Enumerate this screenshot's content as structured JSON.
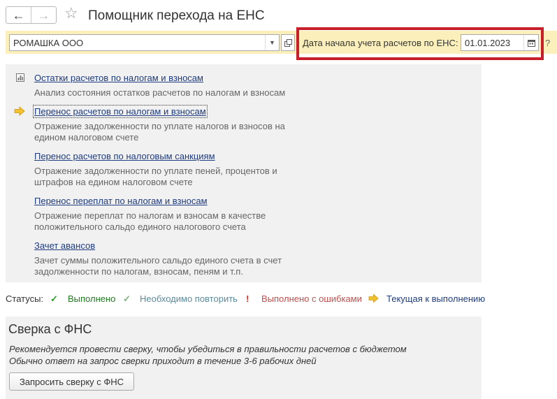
{
  "window": {
    "title": "Помощник перехода на ЕНС",
    "back_icon": "arrow-left-icon",
    "forward_icon": "arrow-right-icon",
    "favorite_icon": "star-icon"
  },
  "filters": {
    "organization": {
      "value": "РОМАШКА ООО"
    },
    "start_date": {
      "label": "Дата начала учета расчетов по ЕНС:",
      "value": "01.01.2023"
    },
    "help_label": "?"
  },
  "steps": [
    {
      "title": "Остатки расчетов по налогам и взносам",
      "description": "Анализ состояния остатков расчетов по налогам и взносам",
      "icon": "report-icon"
    },
    {
      "title": "Перенос расчетов по налогам и взносам",
      "description": "Отражение задолженности по уплате налогов и взносов на едином налоговом счете",
      "icon": "current-arrow-icon"
    },
    {
      "title": "Перенос расчетов по налоговым санкциям",
      "description": "Отражение задолженности по уплате пеней, процентов и штрафов на едином налоговом счете"
    },
    {
      "title": "Перенос переплат по налогам и взносам",
      "description": "Отражение переплат по налогам и взносам в качестве положительного сальдо единого налогового счета"
    },
    {
      "title": "Зачет авансов",
      "description": "Зачет суммы положительного сальдо единого счета в счет задолженности по налогам, взносам, пеням и т.п."
    }
  ],
  "statuses": {
    "label": "Статусы:",
    "items": [
      {
        "label": "Выполнено",
        "color": "#1f7a1f",
        "icon_color": "#2e9e2e",
        "icon": "checkmark-icon"
      },
      {
        "label": "Необходимо повторить",
        "color": "#5c8a9a",
        "icon_color": "#7fb07f",
        "icon": "checkmark-icon"
      },
      {
        "label": "Выполнено с ошибками",
        "color": "#c0504d",
        "icon_color": "#d93025",
        "icon": "exclamation-icon"
      },
      {
        "label": "Текущая к выполнению",
        "color": "#1e3c80",
        "icon_color": "#f2c12e",
        "icon": "arrow-right-icon"
      }
    ]
  },
  "reconciliation": {
    "title": "Сверка с ФНС",
    "note_1": "Рекомендуется провести сверку, чтобы убедиться в правильности расчетов с бюджетом",
    "note_2": "Обычно ответ на запрос сверки приходит в течение 3-6 рабочих дней",
    "button_label": "Запросить сверку с ФНС"
  },
  "colors": {
    "filter_band": "#fbf0bc",
    "highlight_frame": "#c8202a",
    "link": "#1e3c80",
    "panel": "#f1f1f1"
  }
}
